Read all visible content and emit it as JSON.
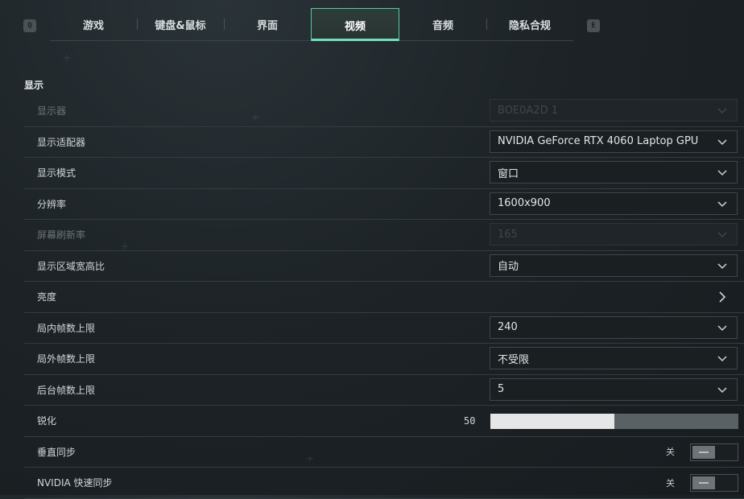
{
  "nav": {
    "prev_key": "Q",
    "next_key": "E",
    "tabs": [
      {
        "label": "游戏",
        "active": false
      },
      {
        "label": "键盘&鼠标",
        "active": false
      },
      {
        "label": "界面",
        "active": false
      },
      {
        "label": "视频",
        "active": true
      },
      {
        "label": "音频",
        "active": false
      },
      {
        "label": "隐私合规",
        "active": false
      }
    ]
  },
  "section": {
    "title": "显示"
  },
  "settings": [
    {
      "label": "显示器",
      "type": "select",
      "value": "BOE0A2D 1",
      "disabled": true
    },
    {
      "label": "显示适配器",
      "type": "select",
      "value": "NVIDIA GeForce RTX 4060 Laptop GPU",
      "disabled": false
    },
    {
      "label": "显示模式",
      "type": "select",
      "value": "窗口",
      "disabled": false
    },
    {
      "label": "分辨率",
      "type": "select",
      "value": "1600x900",
      "disabled": false
    },
    {
      "label": "屏幕刷新率",
      "type": "select",
      "value": "165",
      "disabled": true
    },
    {
      "label": "显示区域宽高比",
      "type": "select",
      "value": "自动",
      "disabled": false
    },
    {
      "label": "亮度",
      "type": "submenu"
    },
    {
      "label": "局内帧数上限",
      "type": "select",
      "value": "240",
      "disabled": false
    },
    {
      "label": "局外帧数上限",
      "type": "select",
      "value": "不受限",
      "disabled": false
    },
    {
      "label": "后台帧数上限",
      "type": "select",
      "value": "5",
      "disabled": false
    },
    {
      "label": "锐化",
      "type": "slider",
      "value": "50",
      "fraction": 0.5
    },
    {
      "label": "垂直同步",
      "type": "toggle",
      "state": "关"
    },
    {
      "label": "NVIDIA 快速同步",
      "type": "toggle",
      "state": "关"
    }
  ],
  "colors": {
    "accent": "#6fe0b8",
    "background": "#1d2327"
  }
}
